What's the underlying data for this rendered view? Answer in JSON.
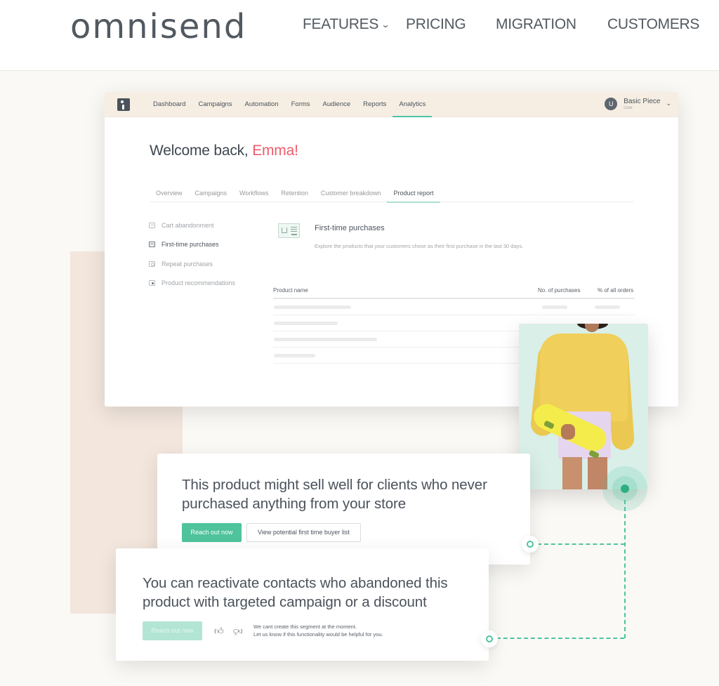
{
  "site": {
    "logo": "omnisend",
    "nav": [
      {
        "label": "FEATURES",
        "has_dropdown": true
      },
      {
        "label": "PRICING"
      },
      {
        "label": "MIGRATION"
      },
      {
        "label": "CUSTOMERS"
      }
    ]
  },
  "app": {
    "nav": [
      "Dashboard",
      "Campaigns",
      "Automation",
      "Forms",
      "Audience",
      "Reports",
      "Analytics"
    ],
    "active_nav": "Analytics",
    "user": {
      "initial": "U",
      "name": "Basic Piece",
      "role": "User"
    },
    "welcome_prefix": "Welcome back, ",
    "welcome_name": "Emma!",
    "tabs": [
      "Overview",
      "Campaigns",
      "Workflows",
      "Retention",
      "Customer breakdown",
      "Product report"
    ],
    "active_tab": "Product report",
    "side_items": [
      {
        "label": "Cart abandonment",
        "icon": "envelope-icon"
      },
      {
        "label": "First-time purchases",
        "icon": "list-icon",
        "active": true
      },
      {
        "label": "Repeat purchases",
        "icon": "repeat-icon"
      },
      {
        "label": "Product recommendations",
        "icon": "star-icon"
      }
    ],
    "section_title": "First-time purchases",
    "section_desc": "Explore the products that your customers chose as their first purchase in the last 30 days.",
    "table": {
      "columns": [
        "Product name",
        "No. of purchases",
        "% of all orders"
      ]
    }
  },
  "cards": [
    {
      "text": "This product might sell well for clients who never purchased anything from your store",
      "primary_button": "Reach out now",
      "secondary_button": "View potential first time buyer list"
    },
    {
      "text": "You can reactivate contacts who abandoned this product with targeted campaign or a discount",
      "primary_button": "Reach out now",
      "primary_disabled": true,
      "feedback_line1": "We cant create this segment at the moment.",
      "feedback_line2": "Let us know if this functionality would be helpful for you."
    }
  ],
  "colors": {
    "accent": "#4fc3a1",
    "highlight_name": "#f05c6c",
    "topbar": "#f6eee3"
  }
}
